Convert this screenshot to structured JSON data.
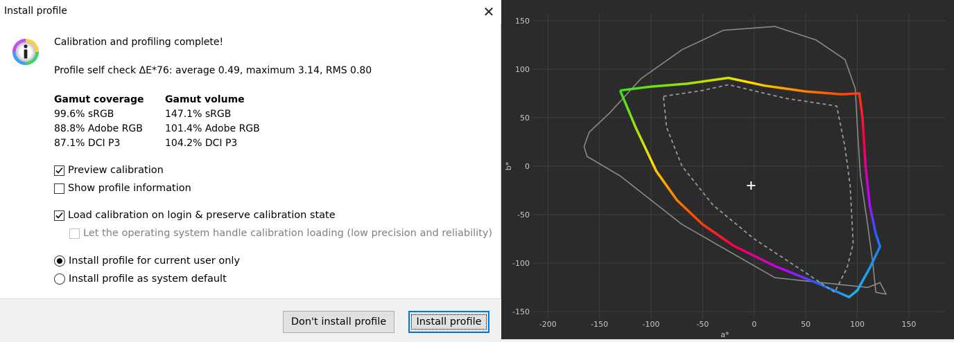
{
  "window": {
    "title": "Install profile",
    "close_icon": "close-icon"
  },
  "message": {
    "headline": "Calibration and profiling complete!",
    "self_check": "Profile self check ΔE*76: average 0.49, maximum 3.14, RMS 0.80"
  },
  "gamut": {
    "coverage_header": "Gamut coverage",
    "volume_header": "Gamut volume",
    "coverage": [
      "99.6% sRGB",
      "88.8% Adobe RGB",
      "87.1% DCI P3"
    ],
    "volume": [
      "147.1% sRGB",
      "101.4% Adobe RGB",
      "104.2% DCI P3"
    ]
  },
  "options": {
    "preview_calibration": {
      "label": "Preview calibration",
      "checked": true
    },
    "show_profile_info": {
      "label": "Show profile information",
      "checked": false
    },
    "load_calibration": {
      "label": "Load calibration on login & preserve calibration state",
      "checked": true
    },
    "os_handle": {
      "label": "Let the operating system handle calibration loading (low precision and reliability)",
      "checked": false,
      "disabled": true
    }
  },
  "install_scope": {
    "current_user": {
      "label": "Install profile for current user only",
      "selected": true
    },
    "system_default": {
      "label": "Install profile as system default",
      "selected": false
    }
  },
  "buttons": {
    "dont_install": "Don't install profile",
    "install": "Install profile"
  },
  "chart_data": {
    "type": "line",
    "xlabel": "a*",
    "ylabel": "b*",
    "xlim": [
      -215,
      185
    ],
    "ylim": [
      -157,
      157
    ],
    "x_ticks": [
      -200,
      -150,
      -100,
      -50,
      0,
      50,
      100,
      150
    ],
    "y_ticks": [
      150,
      100,
      50,
      0,
      -50,
      -100,
      -150
    ],
    "grid": true,
    "white_point": [
      -3,
      -20
    ],
    "series": [
      {
        "style": "gray-outline",
        "points": [
          [
            -165,
            20
          ],
          [
            -160,
            35
          ],
          [
            -140,
            55
          ],
          [
            -110,
            90
          ],
          [
            -70,
            120
          ],
          [
            -30,
            140
          ],
          [
            20,
            144
          ],
          [
            60,
            130
          ],
          [
            88,
            110
          ],
          [
            98,
            80
          ],
          [
            100,
            40
          ],
          [
            103,
            -10
          ],
          [
            110,
            -60
          ],
          [
            115,
            -100
          ],
          [
            118,
            -130
          ],
          [
            128,
            -132
          ],
          [
            122,
            -120
          ],
          [
            110,
            -125
          ],
          [
            20,
            -115
          ],
          [
            -70,
            -60
          ],
          [
            -130,
            -10
          ],
          [
            -162,
            10
          ],
          [
            -165,
            20
          ]
        ]
      },
      {
        "style": "rainbow-solid",
        "points": [
          [
            -130,
            78
          ],
          [
            -100,
            82
          ],
          [
            -65,
            85
          ],
          [
            -25,
            91
          ],
          [
            10,
            83
          ],
          [
            50,
            77
          ],
          [
            85,
            74
          ],
          [
            102,
            75
          ],
          [
            105,
            50
          ],
          [
            108,
            0
          ],
          [
            112,
            -40
          ],
          [
            118,
            -70
          ],
          [
            122,
            -83
          ],
          [
            112,
            -105
          ],
          [
            100,
            -128
          ],
          [
            92,
            -135
          ],
          [
            60,
            -120
          ],
          [
            20,
            -103
          ],
          [
            -20,
            -82
          ],
          [
            -50,
            -60
          ],
          [
            -75,
            -35
          ],
          [
            -95,
            -5
          ],
          [
            -115,
            40
          ],
          [
            -130,
            78
          ]
        ]
      },
      {
        "style": "gray-dashed",
        "points": [
          [
            -88,
            72
          ],
          [
            -50,
            78
          ],
          [
            -25,
            84
          ],
          [
            30,
            70
          ],
          [
            80,
            62
          ],
          [
            88,
            20
          ],
          [
            93,
            -20
          ],
          [
            96,
            -80
          ],
          [
            90,
            -105
          ],
          [
            78,
            -130
          ],
          [
            50,
            -110
          ],
          [
            0,
            -75
          ],
          [
            -40,
            -40
          ],
          [
            -70,
            0
          ],
          [
            -85,
            40
          ],
          [
            -88,
            72
          ]
        ]
      }
    ]
  }
}
